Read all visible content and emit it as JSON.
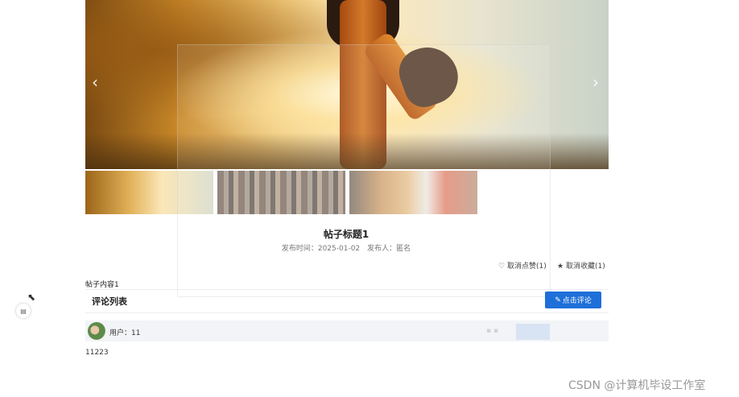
{
  "post": {
    "title": "帖子标题1",
    "meta": "发布时间：2025-01-02　发布人：匿名",
    "unlike_label": "取消点赞(1)",
    "unfavorite_label": "取消收藏(1)",
    "content": "帖子内容1"
  },
  "carousel": {
    "prev_glyph": "‹",
    "next_glyph": "›"
  },
  "comments": {
    "section_title": "评论列表",
    "add_button_label": "点击评论",
    "items": [
      {
        "user_label": "用户：11",
        "text": "11223"
      }
    ]
  },
  "icons": {
    "unlike": "heart-outline-icon",
    "unfavorite": "star-icon",
    "comment": "edit-icon",
    "side": "document-icon"
  },
  "watermark": "CSDN @计算机毕设工作室",
  "colors": {
    "primary": "#1e6fd9"
  }
}
